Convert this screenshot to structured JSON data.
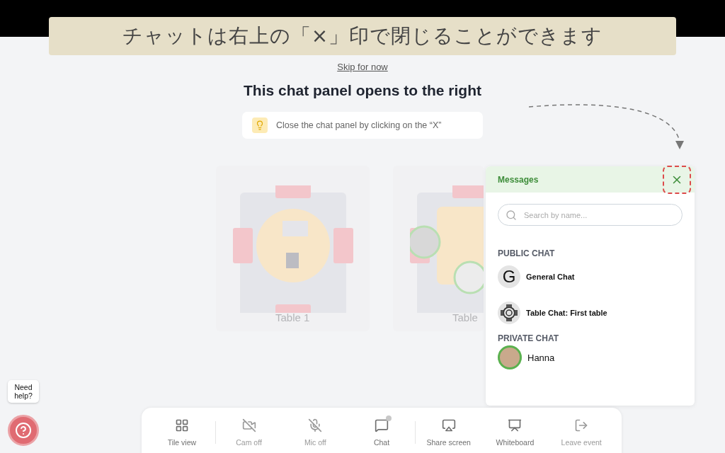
{
  "banner": {
    "text": "チャットは右上の「×」印で閉じることができます"
  },
  "skip_link": "Skip for now",
  "heading": "This chat panel opens to the right",
  "tip": {
    "text": "Close the chat panel by clicking on the “X”"
  },
  "tables": [
    {
      "label": "Table 1"
    },
    {
      "label": "Table"
    }
  ],
  "chat_panel": {
    "title": "Messages",
    "search": {
      "placeholder": "Search by name..."
    },
    "sections": [
      {
        "title": "PUBLIC CHAT",
        "items": [
          {
            "kind": "letter",
            "letter": "G",
            "name": "General Chat"
          },
          {
            "kind": "table",
            "name": "Table Chat: First table"
          }
        ]
      },
      {
        "title": "PRIVATE CHAT",
        "items": [
          {
            "kind": "person",
            "name": "Hanna"
          }
        ]
      }
    ]
  },
  "toolbar": [
    {
      "label": "Tile view",
      "disabled": false
    },
    {
      "label": "Cam off",
      "disabled": true
    },
    {
      "label": "Mic off",
      "disabled": true
    },
    {
      "label": "Chat",
      "disabled": false
    },
    {
      "label": "Share screen",
      "disabled": false
    },
    {
      "label": "Whiteboard",
      "disabled": false
    },
    {
      "label": "Leave event",
      "disabled": true
    }
  ],
  "help": {
    "text": "Need help?"
  }
}
